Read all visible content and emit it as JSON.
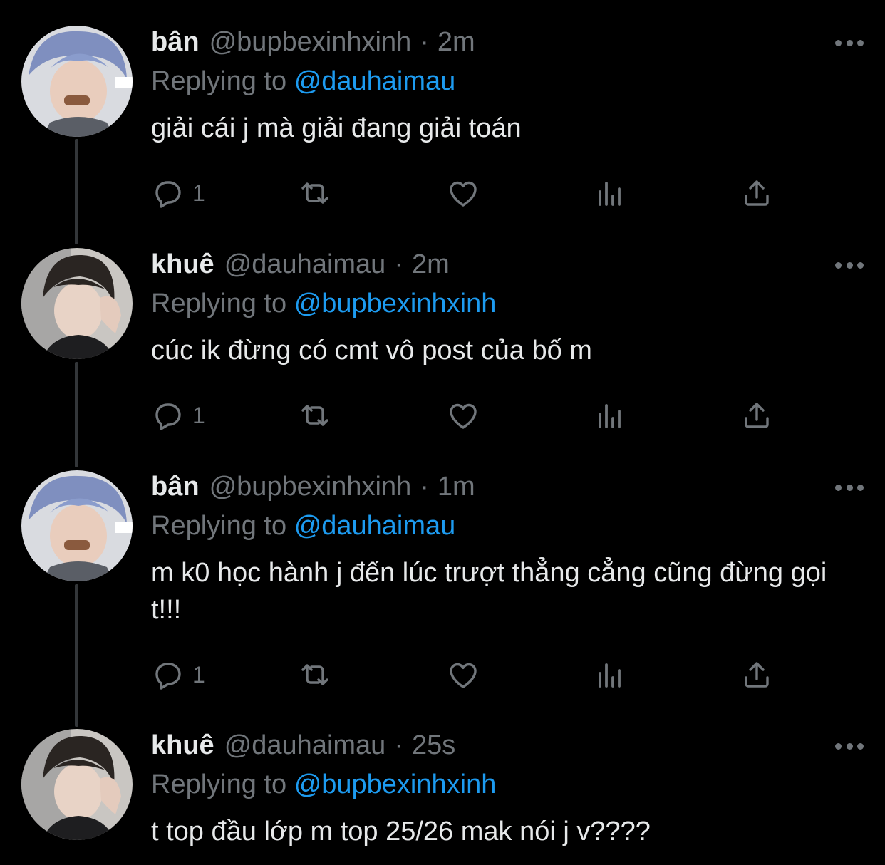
{
  "colors": {
    "background": "#000000",
    "primary_text": "#e7e9ea",
    "secondary_text": "#71767b",
    "accent": "#1d9bf0",
    "thread_line": "#333639"
  },
  "icons": {
    "reply": "reply-bubble-icon",
    "retweet": "retweet-arrows-icon",
    "like": "heart-icon",
    "views": "views-bar-chart-icon",
    "share": "share-upload-icon",
    "more": "more-dots-icon"
  },
  "tweets": [
    {
      "display_name": "bân",
      "handle": "@bupbexinhxinh",
      "separator": "·",
      "time": "2m",
      "replying_prefix": "Replying to",
      "replying_to": "@dauhaimau",
      "text": "giải cái j mà giải đang giải toán",
      "reply_count": "1"
    },
    {
      "display_name": "khuê",
      "handle": "@dauhaimau",
      "separator": "·",
      "time": "2m",
      "replying_prefix": "Replying to",
      "replying_to": "@bupbexinhxinh",
      "text": "cúc ik đừng có cmt vô post của bố m",
      "reply_count": "1"
    },
    {
      "display_name": "bân",
      "handle": "@bupbexinhxinh",
      "separator": "·",
      "time": "1m",
      "replying_prefix": "Replying to",
      "replying_to": "@dauhaimau",
      "text": "m k0 học hành j đến lúc trượt thẳng cẳng cũng đừng gọi t!!!",
      "reply_count": "1"
    },
    {
      "display_name": "khuê",
      "handle": "@dauhaimau",
      "separator": "·",
      "time": "25s",
      "replying_prefix": "Replying to",
      "replying_to": "@bupbexinhxinh",
      "text": "t top đầu lớp m top 25/26 mak nói j v????"
    }
  ]
}
